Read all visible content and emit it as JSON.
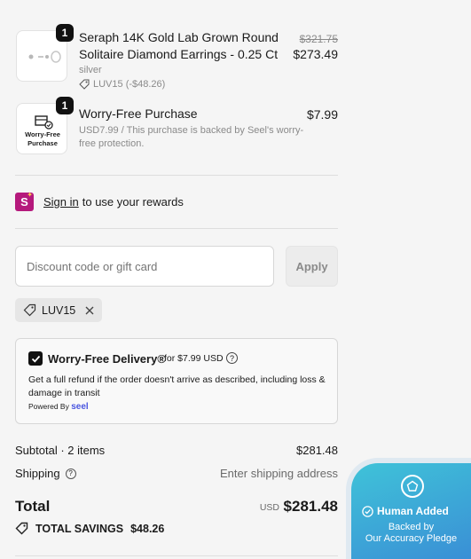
{
  "items": [
    {
      "quantity": "1",
      "title_line1": "Seraph 14K Gold Lab Grown Round",
      "title_line2": "Solitaire Diamond Earrings - 0.25 Ct",
      "variant": "silver",
      "discount": "LUV15 (-$48.26)",
      "original_price": "$321.75",
      "price": "$273.49",
      "thumbnail_icon": "earring-image"
    },
    {
      "quantity": "1",
      "title": "Worry-Free Purchase",
      "description_line1": "USD7.99 / This purchase is backed by Seel's worry-",
      "description_line2": "free protection.",
      "price": "$7.99",
      "thumbnail_label_line1": "Worry-Free",
      "thumbnail_label_line2": "Purchase",
      "thumbnail_icon": "package-shield-icon"
    }
  ],
  "signin": {
    "badge": "S",
    "link": "Sign in",
    "text": "to use your rewards"
  },
  "discount": {
    "placeholder": "Discount code or gift card",
    "apply_label": "Apply",
    "applied_code": "LUV15"
  },
  "worry_free": {
    "title": "Worry-Free Delivery®",
    "price": "for $7.99 USD",
    "description": "Get a full refund if the order doesn't arrive as described, including loss & damage in transit",
    "powered_by": "Powered By",
    "brand": "seel",
    "checked": true
  },
  "summary": {
    "subtotal_label": "Subtotal · 2 items",
    "subtotal_value": "$281.48",
    "shipping_label": "Shipping",
    "shipping_value": "Enter shipping address",
    "total_label": "Total",
    "currency": "USD",
    "total_value": "$281.48",
    "savings_label": "TOTAL SAVINGS",
    "savings_value": "$48.26"
  },
  "pledge_badge": {
    "headline": "Human Added",
    "sub_line1": "Backed by",
    "sub_line2": "Our Accuracy Pledge"
  },
  "colors": {
    "signin_badge": "#b5197c",
    "seel_brand": "#4a56e0",
    "badge_gradient_start": "#3fc3d8",
    "badge_gradient_end": "#3a8fd6"
  }
}
